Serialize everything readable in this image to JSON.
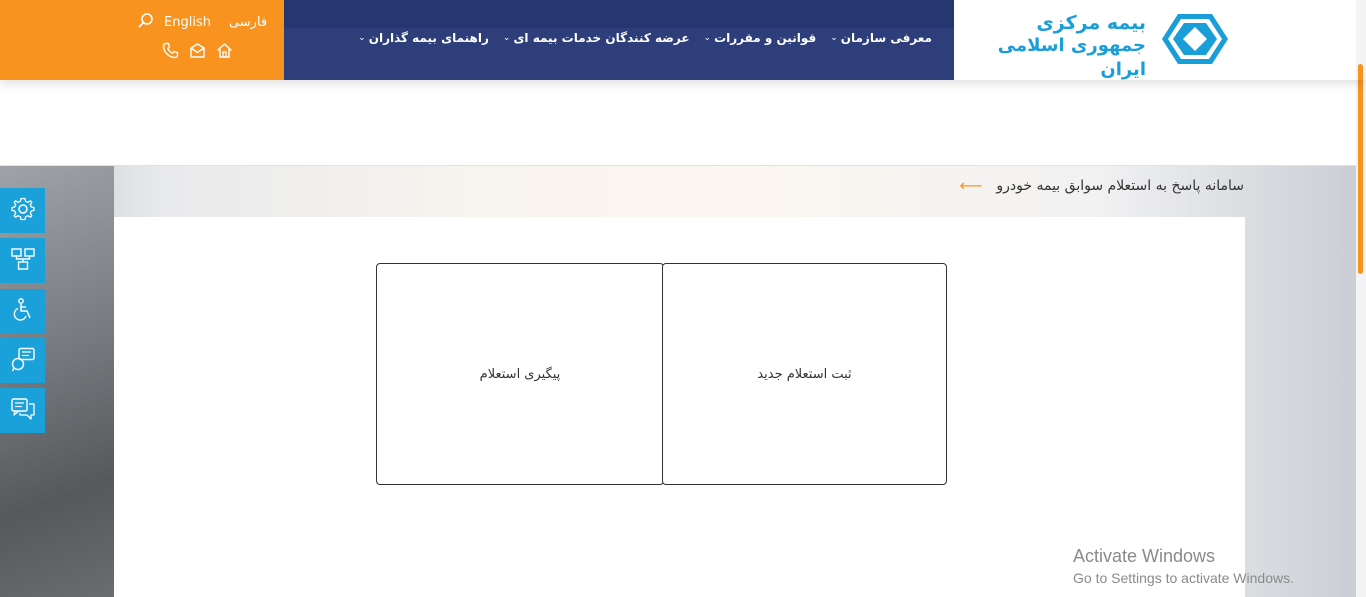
{
  "header": {
    "lang_farsi": "فارسی",
    "lang_english": "English",
    "nav": [
      {
        "label": "معرفی سازمان"
      },
      {
        "label": "قوانین و مقررات"
      },
      {
        "label": "عرضه کنندگان خدمات بیمه ای"
      },
      {
        "label": "راهنمای بیمه گذاران"
      }
    ],
    "logo_line1": "بیمه مرکزی",
    "logo_line2": "جمهوری اسلامی ایران"
  },
  "breadcrumb": {
    "title": "سامانه پاسخ به استعلام سوابق بیمه خودرو"
  },
  "cards": {
    "new_inquiry": "ثبت استعلام جدید",
    "track_inquiry": "پیگیری استعلام"
  },
  "watermark": {
    "line1": "Activate Windows",
    "line2": "Go to Settings to activate Windows."
  },
  "colors": {
    "orange": "#f7931e",
    "navy": "#2d3e7a",
    "logo_blue": "#1a9ed8",
    "side_blue": "#1ba1d9"
  }
}
